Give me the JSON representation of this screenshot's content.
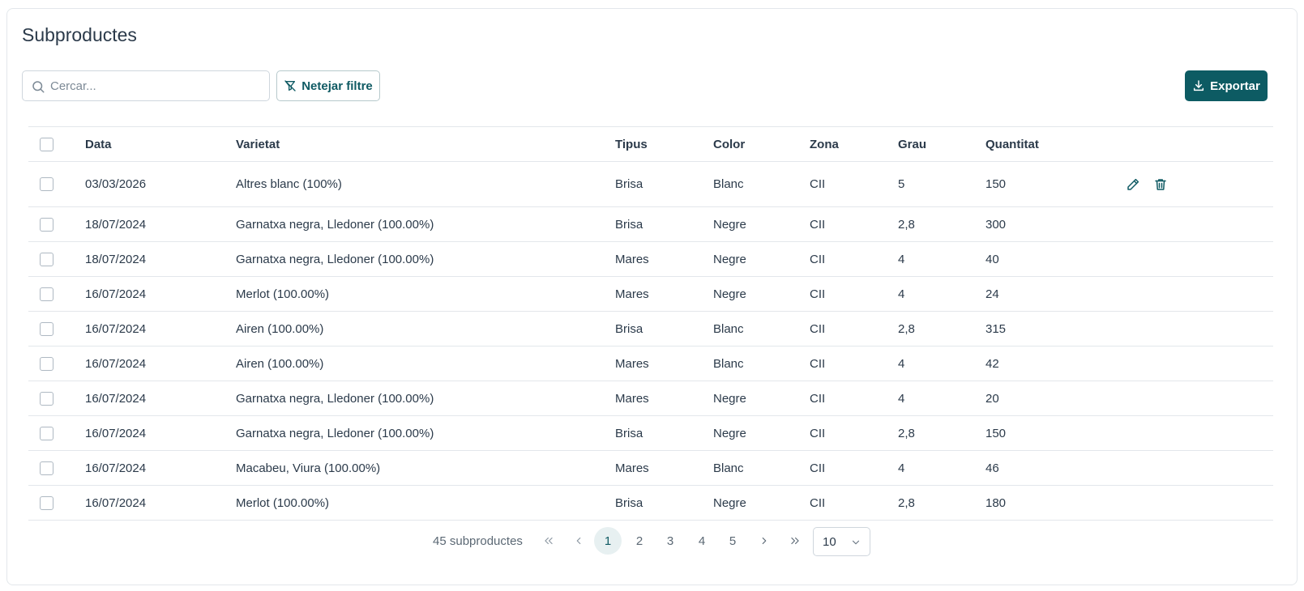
{
  "page": {
    "title": "Subproductes"
  },
  "toolbar": {
    "search_placeholder": "Cercar...",
    "search_value": "",
    "clear_filters_label": "Netejar filtre",
    "export_label": "Exportar"
  },
  "colors": {
    "accent": "#0d5b63",
    "active_page_bg": "#e7f0f1",
    "border": "#e3e7eb"
  },
  "table": {
    "headers": {
      "data": "Data",
      "varietat": "Varietat",
      "tipus": "Tipus",
      "color": "Color",
      "zona": "Zona",
      "grau": "Grau",
      "quantitat": "Quantitat"
    },
    "rows": [
      {
        "data": "03/03/2026",
        "varietat": "Altres blanc (100%)",
        "tipus": "Brisa",
        "color": "Blanc",
        "zona": "CII",
        "grau": "5",
        "quantitat": "150"
      },
      {
        "data": "18/07/2024",
        "varietat": "Garnatxa negra, Lledoner (100.00%)",
        "tipus": "Brisa",
        "color": "Negre",
        "zona": "CII",
        "grau": "2,8",
        "quantitat": "300"
      },
      {
        "data": "18/07/2024",
        "varietat": "Garnatxa negra, Lledoner (100.00%)",
        "tipus": "Mares",
        "color": "Negre",
        "zona": "CII",
        "grau": "4",
        "quantitat": "40"
      },
      {
        "data": "16/07/2024",
        "varietat": "Merlot (100.00%)",
        "tipus": "Mares",
        "color": "Negre",
        "zona": "CII",
        "grau": "4",
        "quantitat": "24"
      },
      {
        "data": "16/07/2024",
        "varietat": "Airen (100.00%)",
        "tipus": "Brisa",
        "color": "Blanc",
        "zona": "CII",
        "grau": "2,8",
        "quantitat": "315"
      },
      {
        "data": "16/07/2024",
        "varietat": "Airen (100.00%)",
        "tipus": "Mares",
        "color": "Blanc",
        "zona": "CII",
        "grau": "4",
        "quantitat": "42"
      },
      {
        "data": "16/07/2024",
        "varietat": "Garnatxa negra, Lledoner (100.00%)",
        "tipus": "Mares",
        "color": "Negre",
        "zona": "CII",
        "grau": "4",
        "quantitat": "20"
      },
      {
        "data": "16/07/2024",
        "varietat": "Garnatxa negra, Lledoner (100.00%)",
        "tipus": "Brisa",
        "color": "Negre",
        "zona": "CII",
        "grau": "2,8",
        "quantitat": "150"
      },
      {
        "data": "16/07/2024",
        "varietat": "Macabeu, Viura (100.00%)",
        "tipus": "Mares",
        "color": "Blanc",
        "zona": "CII",
        "grau": "4",
        "quantitat": "46"
      },
      {
        "data": "16/07/2024",
        "varietat": "Merlot (100.00%)",
        "tipus": "Brisa",
        "color": "Negre",
        "zona": "CII",
        "grau": "2,8",
        "quantitat": "180"
      }
    ],
    "row_action_icons": [
      "pencil-icon",
      "trash-icon"
    ]
  },
  "pagination": {
    "count_label": "45 subproductes",
    "pages": [
      "1",
      "2",
      "3",
      "4",
      "5"
    ],
    "current_page": "1",
    "page_size": "10",
    "icons": {
      "first": "double-chevron-left-icon",
      "prev": "chevron-left-icon",
      "next": "chevron-right-icon",
      "last": "double-chevron-right-icon"
    }
  }
}
